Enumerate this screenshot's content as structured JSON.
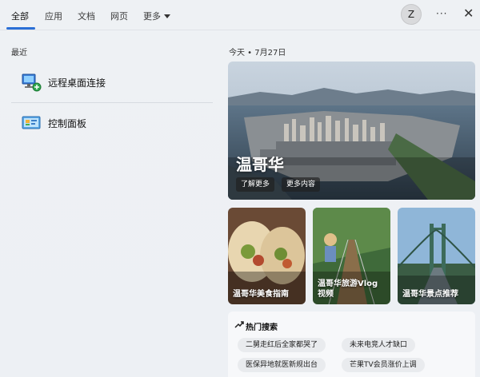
{
  "tabs": [
    {
      "label": "全部"
    },
    {
      "label": "应用"
    },
    {
      "label": "文档"
    },
    {
      "label": "网页"
    },
    {
      "label": "更多"
    }
  ],
  "avatar": {
    "initial": "Z"
  },
  "window": {
    "more_label": "···",
    "close_label": "✕"
  },
  "recent": {
    "title": "最近",
    "items": [
      {
        "label": "远程桌面连接",
        "icon": "remote-desktop-icon"
      },
      {
        "label": "控制面板",
        "icon": "control-panel-icon"
      }
    ]
  },
  "today": {
    "label": "今天 • 7月27日"
  },
  "hero": {
    "title": "温哥华",
    "chips": [
      "了解更多",
      "更多内容"
    ]
  },
  "cards": [
    {
      "title": "温哥华美食指南"
    },
    {
      "title": "温哥华旅游Vlog视频"
    },
    {
      "title": "温哥华景点推荐"
    }
  ],
  "hot_search": {
    "title": "热门搜索",
    "items": [
      "二舅走红后全家都哭了",
      "未来电竞人才缺口",
      "医保异地就医新规出台",
      "芒果TV会员涨价上调"
    ]
  },
  "colors": {
    "accent": "#2b6fd6"
  }
}
